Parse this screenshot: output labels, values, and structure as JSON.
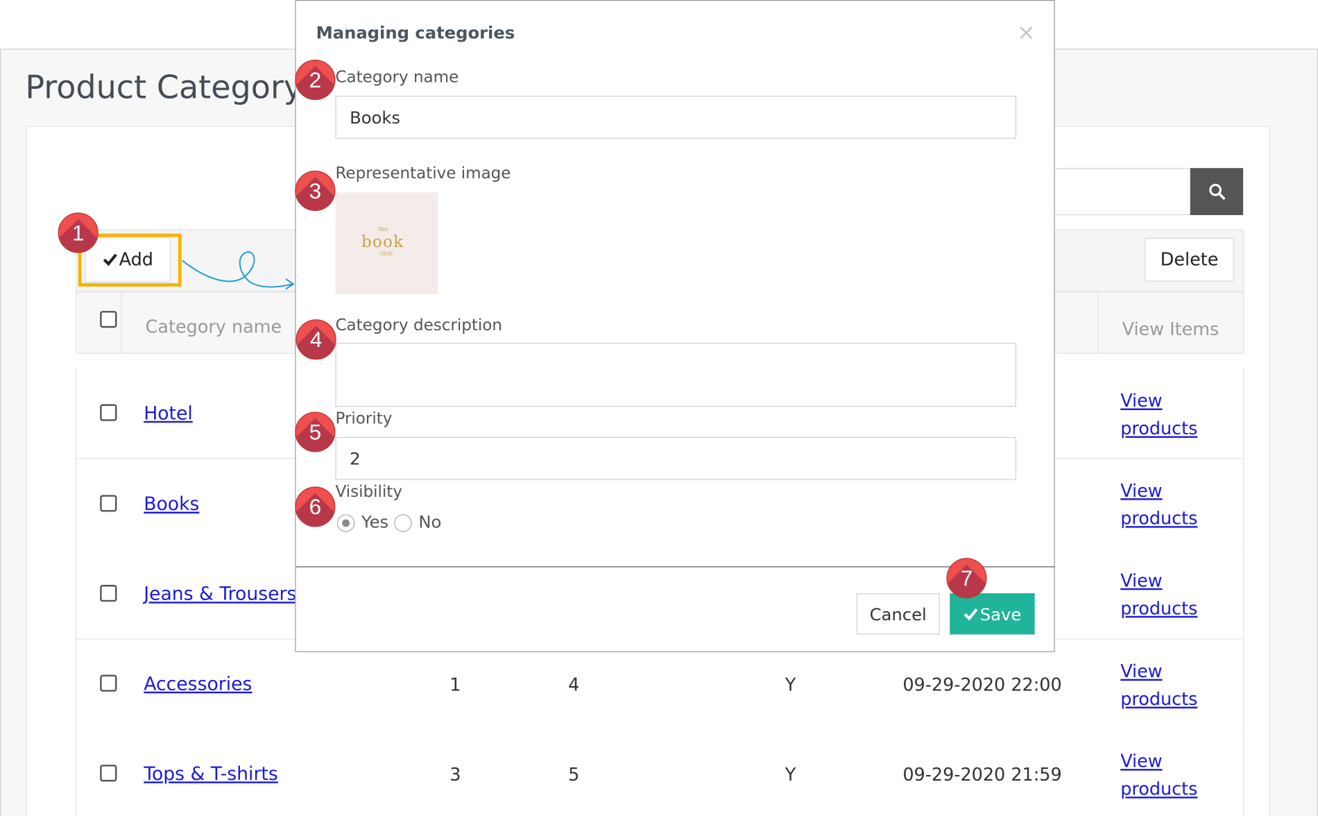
{
  "page": {
    "title": "Product Category",
    "toolbar": {
      "add_label": "Add",
      "delete_label": "Delete"
    },
    "search_icon": "search-icon",
    "table": {
      "columns": {
        "category_name": "Category name",
        "view_items": "View Items"
      },
      "rows": [
        {
          "name": "Hotel",
          "col2": "",
          "col3": "",
          "col4": "",
          "date": "",
          "view1": "View",
          "view2": "products"
        },
        {
          "name": "Books",
          "col2": "",
          "col3": "",
          "col4": "",
          "date": "",
          "view1": "View",
          "view2": "products"
        },
        {
          "name": "Jeans & Trousers",
          "col2": "",
          "col3": "",
          "col4": "",
          "date": "",
          "view1": "View",
          "view2": "products"
        },
        {
          "name": "Accessories",
          "col2": "1",
          "col3": "4",
          "col4": "Y",
          "date": "09-29-2020 22:00",
          "view1": "View",
          "view2": "products"
        },
        {
          "name": "Tops & T-shirts",
          "col2": "3",
          "col3": "5",
          "col4": "Y",
          "date": "09-29-2020 21:59",
          "view1": "View",
          "view2": "products"
        }
      ]
    }
  },
  "modal": {
    "title": "Managing categories",
    "close_icon": "×",
    "category_name_label": "Category name",
    "category_name_value": "Books",
    "image_label": "Representative image",
    "image_text_top": "the",
    "image_text_main": "book",
    "image_text_bottom": "club",
    "description_label": "Category description",
    "description_value": "",
    "priority_label": "Priority",
    "priority_value": "2",
    "visibility_label": "Visibility",
    "visibility_options": [
      "Yes",
      "No"
    ],
    "visibility_selected": "Yes",
    "cancel_label": "Cancel",
    "save_label": "Save"
  },
  "steps": [
    "1",
    "2",
    "3",
    "4",
    "5",
    "6",
    "7"
  ],
  "colors": {
    "accent_save": "#20b49a",
    "highlight": "#f5b301",
    "badge": "#ef4f4f",
    "link": "#1a1adb",
    "arrow": "#1e9bd7"
  }
}
